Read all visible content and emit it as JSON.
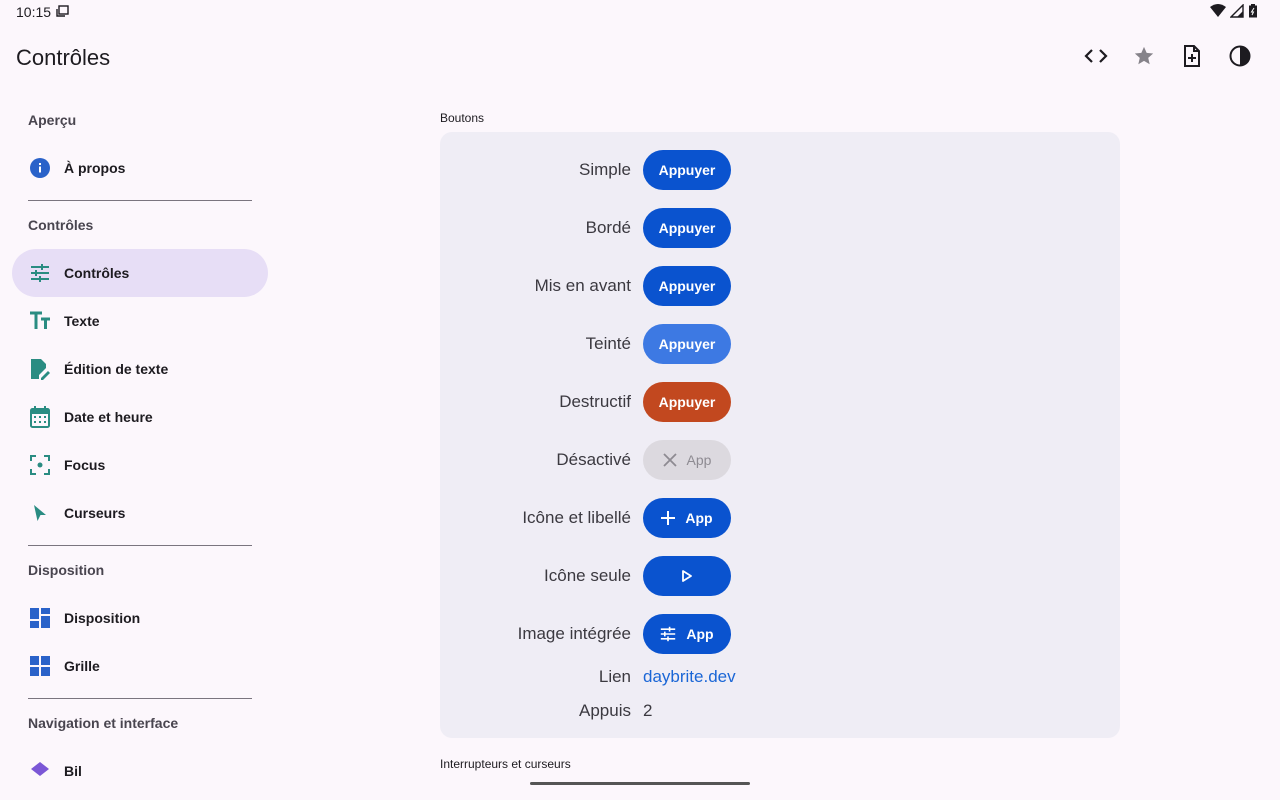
{
  "status_bar": {
    "time": "10:15"
  },
  "app_bar": {
    "title": "Contrôles",
    "actions": [
      "code-icon",
      "star-icon",
      "add-file-icon",
      "contrast-icon"
    ]
  },
  "nav": {
    "section_apercu": "Aperçu",
    "item_apropos": "À propos",
    "section_controles": "Contrôles",
    "item_controles": "Contrôles",
    "item_texte": "Texte",
    "item_edition": "Édition de texte",
    "item_date": "Date et heure",
    "item_focus": "Focus",
    "item_curseurs": "Curseurs",
    "section_disposition": "Disposition",
    "item_disposition": "Disposition",
    "item_grille": "Grille",
    "section_navigation": "Navigation et interface",
    "item_partial": "Bil"
  },
  "main": {
    "section_boutons": "Boutons",
    "section_interrupteurs": "Interrupteurs et curseurs",
    "rows": {
      "simple": {
        "label": "Simple",
        "button": "Appuyer"
      },
      "borde": {
        "label": "Bordé",
        "button": "Appuyer"
      },
      "avant": {
        "label": "Mis en avant",
        "button": "Appuyer"
      },
      "teinte": {
        "label": "Teinté",
        "button": "Appuyer"
      },
      "destructif": {
        "label": "Destructif",
        "button": "Appuyer"
      },
      "desactive": {
        "label": "Désactivé",
        "button": "App"
      },
      "icone_libelle": {
        "label": "Icône et libellé",
        "button": "App"
      },
      "icone_seule": {
        "label": "Icône seule"
      },
      "image": {
        "label": "Image intégrée",
        "button": "App"
      },
      "lien": {
        "label": "Lien",
        "link": "daybrite.dev"
      },
      "appuis": {
        "label": "Appuis",
        "value": "2"
      }
    }
  },
  "colors": {
    "primary": "#0a53cf",
    "tinted": "#3d79e3",
    "destructive": "#c2481f",
    "nav_active": "#e7def6",
    "teal_icon": "#2a8c82",
    "blue_icon": "#2a62c9"
  }
}
